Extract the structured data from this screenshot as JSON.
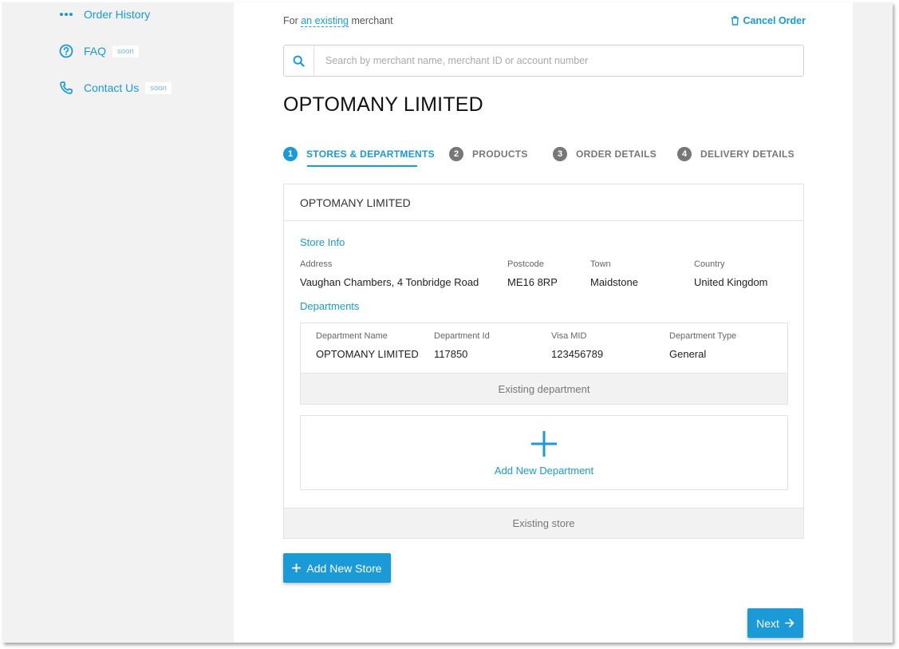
{
  "sidebar": {
    "items": [
      {
        "label": "Order History",
        "icon": "dots-icon",
        "badge": ""
      },
      {
        "label": "FAQ",
        "icon": "help-circle-icon",
        "badge": "soon"
      },
      {
        "label": "Contact Us",
        "icon": "phone-icon",
        "badge": "soon"
      }
    ]
  },
  "header": {
    "for_prefix": "For",
    "for_link": "an existing",
    "for_suffix": "merchant",
    "cancel_label": "Cancel Order"
  },
  "search": {
    "placeholder": "Search by merchant name, merchant ID or account number",
    "value": ""
  },
  "merchant": {
    "name": "OPTOMANY LIMITED"
  },
  "steps": [
    {
      "num": "1",
      "label": "STORES & DEPARTMENTS",
      "active": true
    },
    {
      "num": "2",
      "label": "PRODUCTS",
      "active": false
    },
    {
      "num": "3",
      "label": "ORDER DETAILS",
      "active": false
    },
    {
      "num": "4",
      "label": "DELIVERY DETAILS",
      "active": false
    }
  ],
  "store": {
    "title": "OPTOMANY LIMITED",
    "store_info_label": "Store Info",
    "fields": {
      "address_label": "Address",
      "address": "Vaughan Chambers, 4 Tonbridge Road",
      "postcode_label": "Postcode",
      "postcode": "ME16 8RP",
      "town_label": "Town",
      "town": "Maidstone",
      "country_label": "Country",
      "country": "United Kingdom"
    },
    "departments_label": "Departments",
    "department": {
      "name_label": "Department Name",
      "name": "OPTOMANY LIMITED",
      "id_label": "Department Id",
      "id": "117850",
      "visa_label": "Visa MID",
      "visa": "123456789",
      "type_label": "Department Type",
      "type": "General",
      "footer": "Existing department"
    },
    "add_department_label": "Add New Department",
    "footer": "Existing store"
  },
  "buttons": {
    "add_store": "Add New Store",
    "next": "Next"
  },
  "colors": {
    "accent": "#1a9ad6",
    "step_inactive": "#777777",
    "panel_bg": "#f2f2f2"
  }
}
